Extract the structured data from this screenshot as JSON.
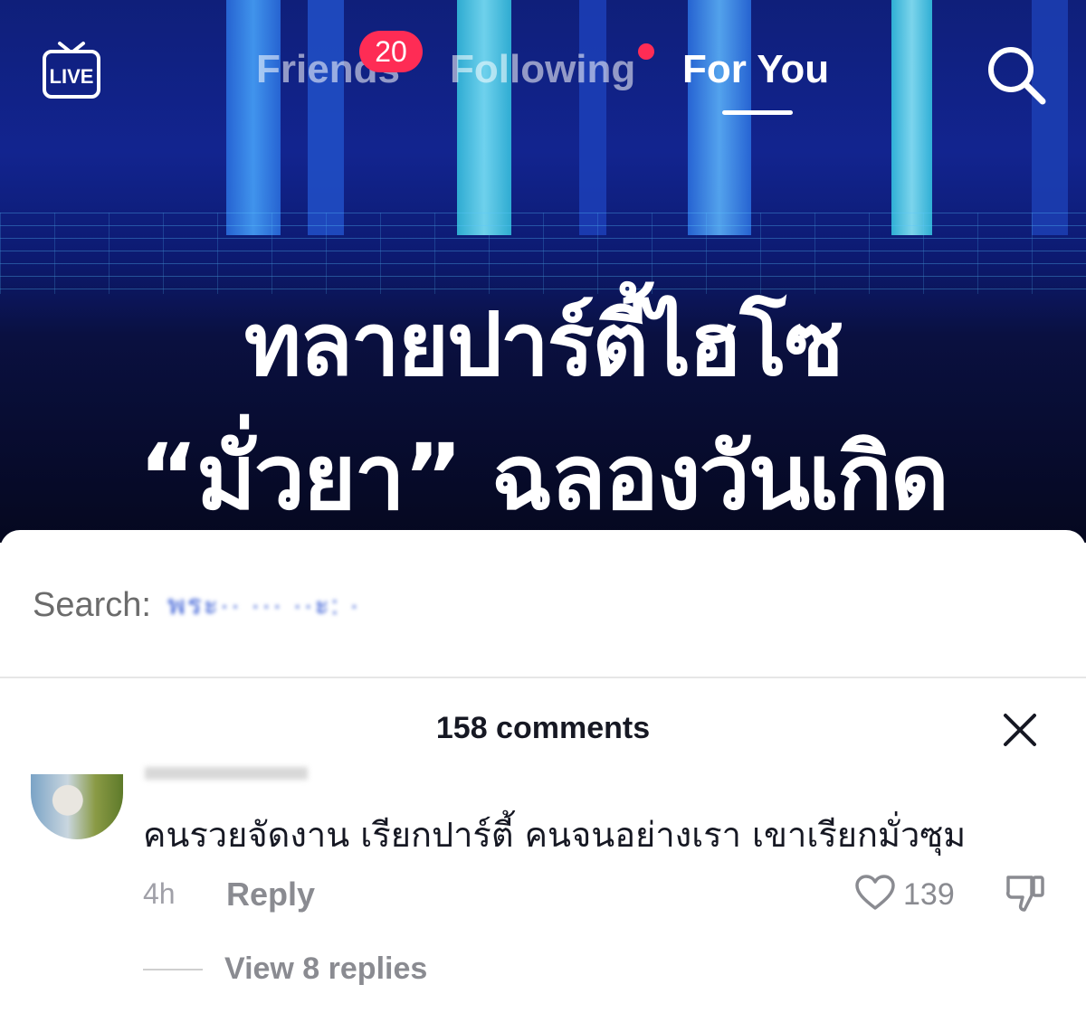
{
  "nav": {
    "live_label": "LIVE",
    "tabs": [
      {
        "label": "Friends",
        "badge": "20"
      },
      {
        "label": "Following",
        "has_dot": true
      },
      {
        "label": "For You",
        "active": true
      }
    ]
  },
  "video": {
    "headline_line1": "ทลายปาร์ตี้ไฮโซ",
    "headline_line2": "“มั่วยา” ฉลองวันเกิด"
  },
  "search": {
    "label": "Search:",
    "query": "พระ·· ··· ··ะ: ·"
  },
  "comments": {
    "count_label": "158 comments",
    "items": [
      {
        "text": "คนรวยจัดงาน  เรียกปาร์ตี้  คนจนอย่างเรา  เขาเรียกมั่วซุม",
        "time": "4h",
        "reply_label": "Reply",
        "likes": "139",
        "view_replies": "View 8 replies"
      }
    ]
  },
  "colors": {
    "accent": "#fe2c55",
    "text": "#161823",
    "muted": "#8a8b91"
  }
}
